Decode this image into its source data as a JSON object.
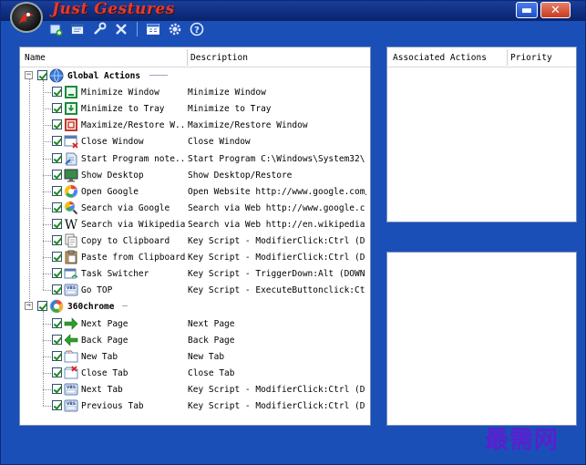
{
  "app": {
    "title": "Just Gestures"
  },
  "window_controls": {
    "minimize": "▬",
    "close": "✕"
  },
  "toolbar": [
    {
      "name": "add-gesture-icon"
    },
    {
      "name": "add-application-icon"
    },
    {
      "name": "edit-wrench-icon"
    },
    {
      "name": "delete-x-icon"
    },
    {
      "name": "properties-window-icon"
    },
    {
      "name": "settings-gear-icon"
    },
    {
      "name": "help-icon"
    }
  ],
  "tree": {
    "columns": {
      "name": "Name",
      "description": "Description"
    },
    "groups": [
      {
        "label": "Global Actions",
        "items": [
          {
            "name": "Minimize Window",
            "description": "Minimize Window",
            "icon": "minimize-window-icon"
          },
          {
            "name": "Minimize to Tray",
            "description": "Minimize to Tray",
            "icon": "minimize-tray-icon"
          },
          {
            "name": "Maximize/Restore W...",
            "description": "Maximize/Restore Window",
            "icon": "maximize-restore-icon"
          },
          {
            "name": "Close Window",
            "description": "Close Window",
            "icon": "close-window-icon"
          },
          {
            "name": "Start Program note...",
            "description": "Start Program C:\\Windows\\System32\\...",
            "icon": "start-program-icon"
          },
          {
            "name": "Show Desktop",
            "description": "Show Desktop/Restore",
            "icon": "show-desktop-icon"
          },
          {
            "name": "Open Google",
            "description": "Open Website http://www.google.com/",
            "icon": "google-icon"
          },
          {
            "name": "Search via Google",
            "description": "Search via Web http://www.google.c...",
            "icon": "google-search-icon"
          },
          {
            "name": "Search via Wikipedia",
            "description": "Search via Web http://en.wikipedia...",
            "icon": "wikipedia-icon"
          },
          {
            "name": "Copy to Clipboard",
            "description": "Key Script - ModifierClick:Ctrl (D...",
            "icon": "copy-icon"
          },
          {
            "name": "Paste from Clipboard",
            "description": "Key Script - ModifierClick:Ctrl (D...",
            "icon": "paste-icon"
          },
          {
            "name": "Task Switcher",
            "description": "Key Script - TriggerDown:Alt (DOWN...",
            "icon": "task-switcher-icon"
          },
          {
            "name": "Go TOP",
            "description": "Key Script - ExecuteButtonclick:Ct...",
            "icon": "key-script-icon"
          }
        ]
      },
      {
        "label": "360chrome",
        "items": [
          {
            "name": "Next Page",
            "description": "Next Page",
            "icon": "arrow-right-icon"
          },
          {
            "name": "Back Page",
            "description": "Back Page",
            "icon": "arrow-left-icon"
          },
          {
            "name": "New Tab",
            "description": "New Tab",
            "icon": "new-tab-icon"
          },
          {
            "name": "Close Tab",
            "description": "Close Tab",
            "icon": "close-tab-icon"
          },
          {
            "name": "Next Tab",
            "description": "Key Script - ModifierClick:Ctrl (D...",
            "icon": "key-script-icon"
          },
          {
            "name": "Previous Tab",
            "description": "Key Script - ModifierClick:Ctrl (D...",
            "icon": "key-script-icon"
          }
        ]
      }
    ]
  },
  "associated": {
    "columns": {
      "actions": "Associated Actions",
      "priority": "Priority"
    }
  },
  "watermark": "最需网"
}
